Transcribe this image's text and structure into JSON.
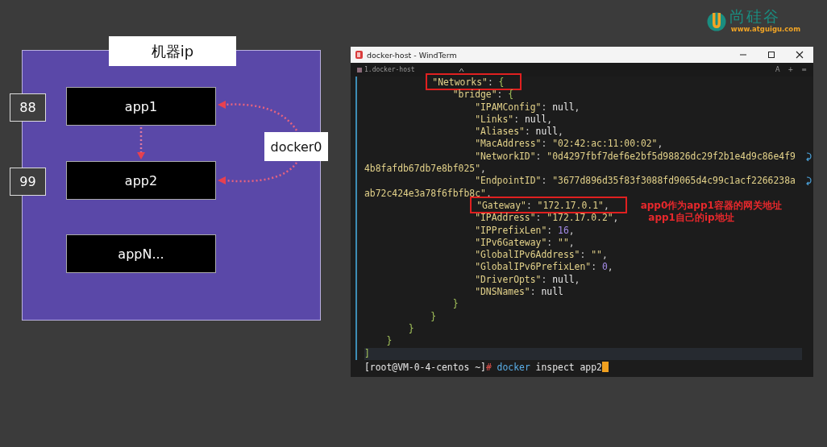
{
  "logo": {
    "name": "尚硅谷",
    "url": "www.atguigu.com"
  },
  "diagram": {
    "title": "机器ip",
    "bridge": "docker0",
    "hosts": [
      {
        "label": "app1",
        "port": "88"
      },
      {
        "label": "app2",
        "port": "99"
      },
      {
        "label": "appN..."
      }
    ]
  },
  "terminal": {
    "title": "docker-host - WindTerm",
    "tab": "1.docker-host",
    "tab_actions": [
      "A",
      "+",
      "≡"
    ],
    "lines": [
      {
        "segments": [
          {
            "kind": "str",
            "text": "            \"Networks\""
          },
          {
            "kind": "punct",
            "text": ": "
          },
          {
            "kind": "brace",
            "text": "{"
          }
        ],
        "boxed": true
      },
      {
        "segments": [
          {
            "kind": "str",
            "text": "                \"bridge\""
          },
          {
            "kind": "punct",
            "text": ": "
          },
          {
            "kind": "brace",
            "text": "{"
          }
        ]
      },
      {
        "segments": [
          {
            "kind": "str",
            "text": "                    \"IPAMConfig\""
          },
          {
            "kind": "punct",
            "text": ": "
          },
          {
            "kind": "null",
            "text": "null"
          },
          {
            "kind": "punct",
            "text": ","
          }
        ]
      },
      {
        "segments": [
          {
            "kind": "str",
            "text": "                    \"Links\""
          },
          {
            "kind": "punct",
            "text": ": "
          },
          {
            "kind": "null",
            "text": "null"
          },
          {
            "kind": "punct",
            "text": ","
          }
        ]
      },
      {
        "segments": [
          {
            "kind": "str",
            "text": "                    \"Aliases\""
          },
          {
            "kind": "punct",
            "text": ": "
          },
          {
            "kind": "null",
            "text": "null"
          },
          {
            "kind": "punct",
            "text": ","
          }
        ]
      },
      {
        "segments": [
          {
            "kind": "str",
            "text": "                    \"MacAddress\""
          },
          {
            "kind": "punct",
            "text": ": "
          },
          {
            "kind": "str",
            "text": "\"02:42:ac:11:00:02\""
          },
          {
            "kind": "punct",
            "text": ","
          }
        ]
      },
      {
        "segments": [
          {
            "kind": "str",
            "text": "                    \"NetworkID\""
          },
          {
            "kind": "punct",
            "text": ": "
          },
          {
            "kind": "str",
            "text": "\"0d4297fbf7def6e2bf5d98826dc29f2b1e4d9c86e4f9"
          }
        ],
        "wraps": true
      },
      {
        "segments": [
          {
            "kind": "str",
            "text": "4b8fafdb67db7e8bf025\""
          },
          {
            "kind": "punct",
            "text": ","
          }
        ]
      },
      {
        "segments": [
          {
            "kind": "str",
            "text": "                    \"EndpointID\""
          },
          {
            "kind": "punct",
            "text": ": "
          },
          {
            "kind": "str",
            "text": "\"3677d896d35f83f3088fd9065d4c99c1acf2266238a"
          }
        ],
        "wraps": true
      },
      {
        "segments": [
          {
            "kind": "str",
            "text": "ab72c424e3a78f6fbfb8c\""
          },
          {
            "kind": "punct",
            "text": ","
          }
        ]
      },
      {
        "segments": [
          {
            "kind": "str",
            "text": "                    \"Gateway\""
          },
          {
            "kind": "punct",
            "text": ": "
          },
          {
            "kind": "str",
            "text": "\"172.17.0.1\""
          },
          {
            "kind": "punct",
            "text": ","
          }
        ],
        "boxed": true,
        "note": "app0作为app1容器的网关地址"
      },
      {
        "segments": [
          {
            "kind": "str",
            "text": "                    \"IPAddress\""
          },
          {
            "kind": "punct",
            "text": ": "
          },
          {
            "kind": "str",
            "text": "\"172.17.0.2\""
          },
          {
            "kind": "punct",
            "text": ","
          }
        ],
        "note": "app1自己的ip地址"
      },
      {
        "segments": [
          {
            "kind": "str",
            "text": "                    \"IPPrefixLen\""
          },
          {
            "kind": "punct",
            "text": ": "
          },
          {
            "kind": "num",
            "text": "16"
          },
          {
            "kind": "punct",
            "text": ","
          }
        ]
      },
      {
        "segments": [
          {
            "kind": "str",
            "text": "                    \"IPv6Gateway\""
          },
          {
            "kind": "punct",
            "text": ": "
          },
          {
            "kind": "str",
            "text": "\"\""
          },
          {
            "kind": "punct",
            "text": ","
          }
        ]
      },
      {
        "segments": [
          {
            "kind": "str",
            "text": "                    \"GlobalIPv6Address\""
          },
          {
            "kind": "punct",
            "text": ": "
          },
          {
            "kind": "str",
            "text": "\"\""
          },
          {
            "kind": "punct",
            "text": ","
          }
        ]
      },
      {
        "segments": [
          {
            "kind": "str",
            "text": "                    \"GlobalIPv6PrefixLen\""
          },
          {
            "kind": "punct",
            "text": ": "
          },
          {
            "kind": "num",
            "text": "0"
          },
          {
            "kind": "punct",
            "text": ","
          }
        ]
      },
      {
        "segments": [
          {
            "kind": "str",
            "text": "                    \"DriverOpts\""
          },
          {
            "kind": "punct",
            "text": ": "
          },
          {
            "kind": "null",
            "text": "null"
          },
          {
            "kind": "punct",
            "text": ","
          }
        ]
      },
      {
        "segments": [
          {
            "kind": "str",
            "text": "                    \"DNSNames\""
          },
          {
            "kind": "punct",
            "text": ": "
          },
          {
            "kind": "null",
            "text": "null"
          }
        ]
      },
      {
        "segments": [
          {
            "kind": "brace",
            "text": "                }"
          }
        ]
      },
      {
        "segments": [
          {
            "kind": "brace",
            "text": "            }"
          }
        ]
      },
      {
        "segments": [
          {
            "kind": "brace",
            "text": "        }"
          }
        ]
      },
      {
        "segments": [
          {
            "kind": "brace",
            "text": "    }"
          }
        ]
      },
      {
        "segments": [
          {
            "kind": "brace",
            "text": "]"
          }
        ],
        "current": true
      }
    ],
    "prompt": {
      "segments": [
        {
          "kind": "prompt",
          "text": "[root@VM-0-4-centos ~]"
        },
        {
          "kind": "hash",
          "text": "#"
        },
        {
          "kind": "command",
          "text": " docker"
        },
        {
          "kind": "args",
          "text": " inspect app2"
        }
      ],
      "cursor": true
    }
  }
}
